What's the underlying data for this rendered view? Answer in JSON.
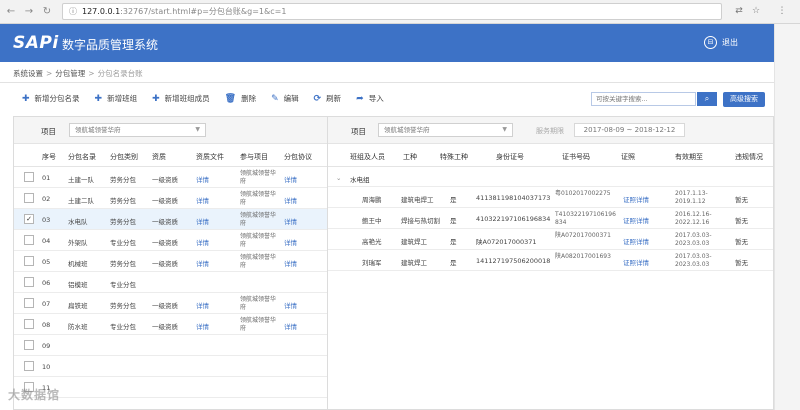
{
  "browser": {
    "url_host": "127.0.0.1",
    "url_path": ":32767/start.html#p=分包台账&g=1&c=1"
  },
  "app": {
    "logo": "SAPi",
    "title": "数字品质管理系统",
    "logout": "退出"
  },
  "breadcrumb": [
    "系统设置",
    "分包管理",
    "分包名录台账"
  ],
  "toolbar": [
    {
      "icon": "plus-icon",
      "label": "新增分包名录"
    },
    {
      "icon": "plus-icon",
      "label": "新增班组"
    },
    {
      "icon": "plus-icon",
      "label": "新增班组成员"
    },
    {
      "icon": "trash-icon",
      "label": "删除"
    },
    {
      "icon": "edit-icon",
      "label": "编辑"
    },
    {
      "icon": "refresh-icon",
      "label": "刷新"
    },
    {
      "icon": "export-icon",
      "label": "导入"
    }
  ],
  "search": {
    "placeholder": "可按关键字搜索...",
    "advanced": "高级搜索"
  },
  "left": {
    "project_label": "项目",
    "project_value": "领航城领誉华府",
    "headers": [
      "序号",
      "分包名录",
      "分包类别",
      "资质",
      "资质文件",
      "参与项目",
      "分包协议"
    ],
    "rows": [
      {
        "checked": false,
        "no": "01",
        "name": "土建一队",
        "category": "劳务分包",
        "level": "一级资质",
        "file": "详情",
        "project": "领航城领誉华府",
        "agreement": "详情"
      },
      {
        "checked": false,
        "no": "02",
        "name": "土建二队",
        "category": "劳务分包",
        "level": "一级资质",
        "file": "详情",
        "project": "领航城领誉华府",
        "agreement": "详情"
      },
      {
        "checked": true,
        "no": "03",
        "name": "水电队",
        "category": "劳务分包",
        "level": "一级资质",
        "file": "详情",
        "project": "领航城领誉华府",
        "agreement": "详情"
      },
      {
        "checked": false,
        "no": "04",
        "name": "外架队",
        "category": "专业分包",
        "level": "一级资质",
        "file": "详情",
        "project": "领航城领誉华府",
        "agreement": "详情"
      },
      {
        "checked": false,
        "no": "05",
        "name": "机械班",
        "category": "劳务分包",
        "level": "一级资质",
        "file": "详情",
        "project": "领航城领誉华府",
        "agreement": "详情"
      },
      {
        "checked": false,
        "no": "06",
        "name": "铝模班",
        "category": "专业分包",
        "level": "",
        "file": "",
        "project": "",
        "agreement": ""
      },
      {
        "checked": false,
        "no": "07",
        "name": "扁铁班",
        "category": "劳务分包",
        "level": "一级资质",
        "file": "详情",
        "project": "领航城领誉华府",
        "agreement": "详情"
      },
      {
        "checked": false,
        "no": "08",
        "name": "防水班",
        "category": "专业分包",
        "level": "一级资质",
        "file": "详情",
        "project": "领航城领誉华府",
        "agreement": "详情"
      },
      {
        "checked": false,
        "no": "09",
        "name": "",
        "category": "",
        "level": "",
        "file": "",
        "project": "",
        "agreement": ""
      },
      {
        "checked": false,
        "no": "10",
        "name": "",
        "category": "",
        "level": "",
        "file": "",
        "project": "",
        "agreement": ""
      },
      {
        "checked": false,
        "no": "11",
        "name": "",
        "category": "",
        "level": "",
        "file": "",
        "project": "",
        "agreement": ""
      }
    ]
  },
  "right": {
    "project_label": "项目",
    "project_value": "领航城领誉华府",
    "period_label": "服务期限",
    "period_value": "2017-08-09 ~ 2018-12-12",
    "headers": [
      "班组及人员",
      "工种",
      "特殊工种",
      "身份证号",
      "证书号码",
      "证照",
      "有效期至",
      "违规情况"
    ],
    "group_name": "水电组",
    "rows": [
      {
        "name": "周海鹏",
        "trade": "建筑电焊工",
        "special": "是",
        "id": "411381198104037173",
        "cert": "粤0102017002275",
        "license": "证照详情",
        "valid": "2017.1.13-2019.1.12",
        "violation": "暂无"
      },
      {
        "name": "鲍王中",
        "trade": "焊接与热切割",
        "special": "是",
        "id": "410322197106196834",
        "cert": "T410322197106196834",
        "license": "证照详情",
        "valid": "2016.12.16-2022.12.16",
        "violation": "暂无"
      },
      {
        "name": "高艳光",
        "trade": "建筑焊工",
        "special": "是",
        "id": "陕A072017000371",
        "cert": "陕A072017000371",
        "license": "证照详情",
        "valid": "2017.03.03-2023.03.03",
        "violation": "暂无"
      },
      {
        "name": "刘瑞军",
        "trade": "建筑焊工",
        "special": "是",
        "id": "141127197506200018",
        "cert": "陕A082017001693",
        "license": "证照详情",
        "valid": "2017.03.03-2023.03.03",
        "violation": "暂无"
      }
    ]
  },
  "watermark": "大数据馆"
}
